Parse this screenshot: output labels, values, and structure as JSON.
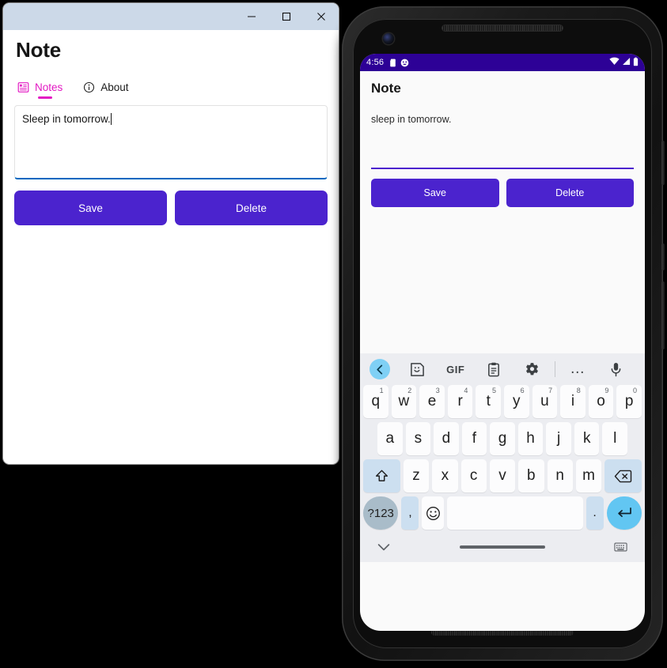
{
  "desktop": {
    "window_controls": {
      "minimize": "—",
      "maximize": "□",
      "close": "✕"
    },
    "app_title": "Note",
    "tabs": [
      {
        "label": "Notes",
        "icon": "list-notes-icon",
        "active": true
      },
      {
        "label": "About",
        "icon": "info-circle-icon",
        "active": false
      }
    ],
    "note_input": {
      "value": "Sleep in tomorrow.",
      "placeholder": "",
      "focused": true,
      "accent_color": "#0067c0"
    },
    "buttons": {
      "save_label": "Save",
      "delete_label": "Delete",
      "color": "#4b23ce"
    }
  },
  "phone": {
    "status_bar": {
      "time": "4:56",
      "left_icons": [
        "sd-card-icon",
        "smiley-face-icon"
      ],
      "right_icons": [
        "wifi-icon",
        "cell-signal-icon",
        "battery-icon"
      ],
      "background": "#2d0196"
    },
    "app": {
      "title": "Note",
      "note_value": "sleep in tomorrow.",
      "field_accent": "#4b23ce",
      "save_label": "Save",
      "delete_label": "Delete",
      "button_color": "#4b23ce"
    },
    "keyboard": {
      "toolbar": [
        "back-chevron-icon",
        "sticker-icon",
        "gif-icon",
        "clipboard-icon",
        "settings-gear-icon",
        "divider",
        "more-options-icon",
        "microphone-icon"
      ],
      "gif_label": "GIF",
      "more_label": "…",
      "row1": [
        {
          "key": "q",
          "num": "1"
        },
        {
          "key": "w",
          "num": "2"
        },
        {
          "key": "e",
          "num": "3"
        },
        {
          "key": "r",
          "num": "4"
        },
        {
          "key": "t",
          "num": "5"
        },
        {
          "key": "y",
          "num": "6"
        },
        {
          "key": "u",
          "num": "7"
        },
        {
          "key": "i",
          "num": "8"
        },
        {
          "key": "o",
          "num": "9"
        },
        {
          "key": "p",
          "num": "0"
        }
      ],
      "row2": [
        "a",
        "s",
        "d",
        "f",
        "g",
        "h",
        "j",
        "k",
        "l"
      ],
      "row3": {
        "shift": "shift-arrow-icon",
        "letters": [
          "z",
          "x",
          "c",
          "v",
          "b",
          "n",
          "m"
        ],
        "backspace": "backspace-icon"
      },
      "row4": {
        "symbols_label": "?123",
        "comma": ",",
        "emoji": "emoji-smiley-icon",
        "space": "",
        "period": ".",
        "enter": "enter-return-icon"
      },
      "bottom_bar": {
        "hide_keyboard": "chevron-down-icon",
        "switch_keyboard": "keyboard-icon"
      }
    }
  }
}
